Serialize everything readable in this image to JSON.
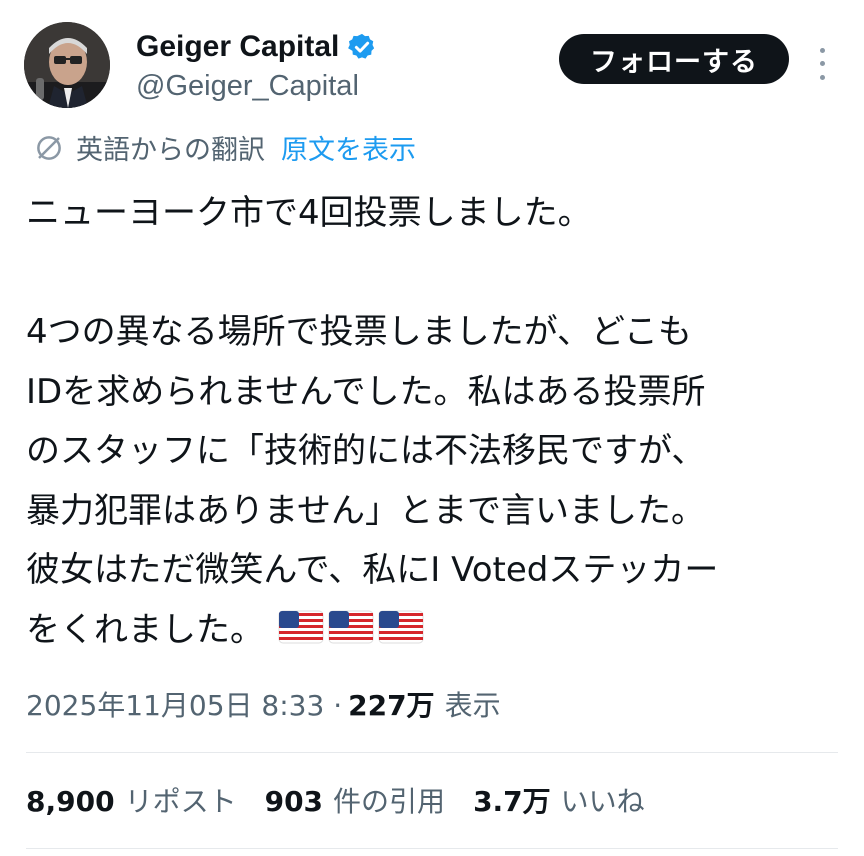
{
  "author": {
    "display_name": "Geiger Capital",
    "handle": "@Geiger_Capital",
    "verified_color": "#1d9bf0"
  },
  "follow_label": "フォローする",
  "translation": {
    "label": "英語からの翻訳",
    "show_original": "原文を表示"
  },
  "tweet": {
    "lines": [
      "ニューヨーク市で4回投票しました。",
      "",
      "4つの異なる場所で投票しましたが、どこも",
      "IDを求められませんでした。私はある投票所",
      "のスタッフに「技術的には不法移民ですが、",
      "暴力犯罪はありません」とまで言いました。",
      "彼女はただ微笑んで、私にI Votedステッカー",
      "をくれました。"
    ],
    "emoji": [
      "flag-us",
      "flag-us",
      "flag-us"
    ]
  },
  "meta": {
    "timestamp": "2025年11月05日 8:33 ·",
    "views": "227万",
    "views_label": "表示"
  },
  "stats": [
    {
      "value": "8,900",
      "label": "リポスト"
    },
    {
      "value": "903",
      "label": "件の引用"
    },
    {
      "value": "3.7万",
      "label": "いいね"
    }
  ]
}
